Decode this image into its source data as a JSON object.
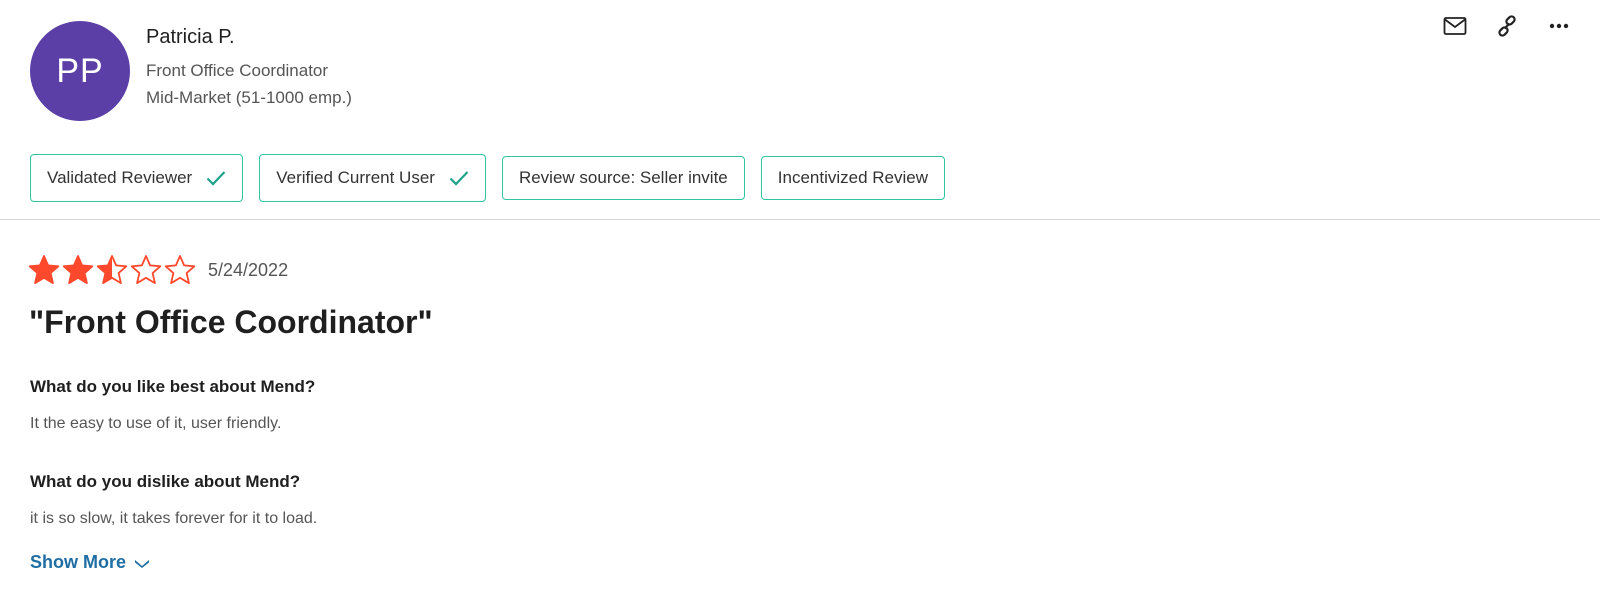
{
  "reviewer": {
    "initials": "PP",
    "name": "Patricia P.",
    "title": "Front Office Coordinator",
    "segment": "Mid-Market (51-1000 emp.)",
    "avatar_color": "#5b3ea6"
  },
  "actions": {
    "icons": [
      "mail-icon",
      "link-icon",
      "more-icon"
    ]
  },
  "badges": [
    {
      "label": "Validated Reviewer",
      "icon": "check-icon"
    },
    {
      "label": "Verified Current User",
      "icon": "check-icon"
    },
    {
      "label": "Review source: Seller invite"
    },
    {
      "label": "Incentivized Review"
    }
  ],
  "review": {
    "rating": 2.5,
    "rating_max": 5,
    "date": "5/24/2022",
    "title": "\"Front Office Coordinator\"",
    "q1": "What do you like best about Mend?",
    "a1": "It the easy to use of it, user friendly.",
    "q2": "What do you dislike about Mend?",
    "a2": "it is so slow, it takes forever for it to load.",
    "show_more": "Show More"
  },
  "colors": {
    "star": "#ff492c",
    "badge_border": "#2fc5a3",
    "check": "#1fa28a",
    "link": "#1f6ea3"
  }
}
